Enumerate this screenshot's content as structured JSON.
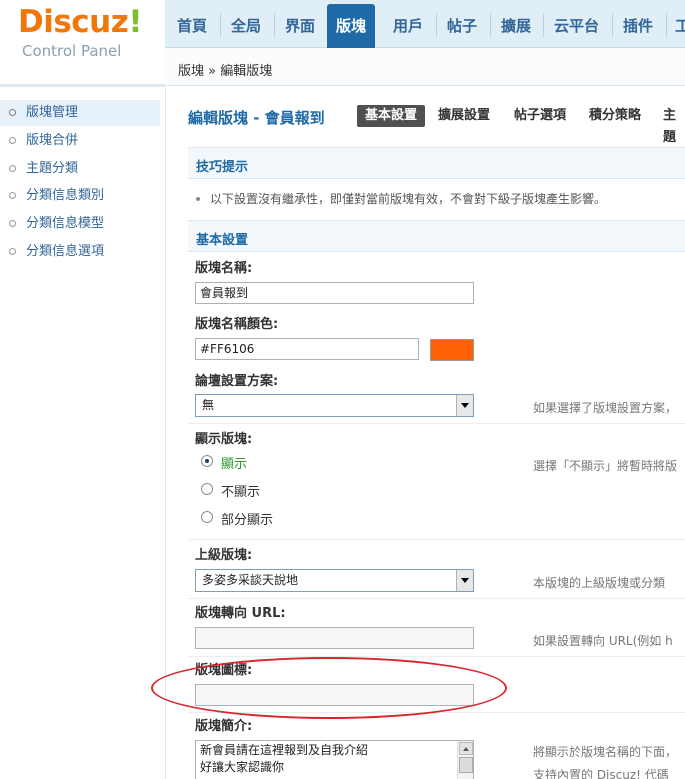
{
  "logo": {
    "brand": "Discuz",
    "bang": "!",
    "subtitle": "Control Panel"
  },
  "topnav": {
    "tabs": [
      "首頁",
      "全局",
      "界面",
      "版塊",
      "用戶",
      "帖子",
      "擴展",
      "云平台",
      "插件",
      "工"
    ],
    "active_index": 3
  },
  "breadcrumb": {
    "text": "版塊 » 編輯版塊"
  },
  "sidebar": {
    "items": [
      "版塊管理",
      "版塊合併",
      "主題分類",
      "分類信息類別",
      "分類信息模型",
      "分類信息選項"
    ],
    "active_index": 0
  },
  "main": {
    "title": "編輯版塊 - 會員報到",
    "subtabs": [
      "基本設置",
      "擴展設置",
      "帖子選項",
      "積分策略",
      "主題"
    ],
    "active_subtab": 0
  },
  "tips": {
    "heading": "技巧提示",
    "text": "以下設置沒有繼承性，即僅對當前版塊有效，不會對下級子版塊產生影響。"
  },
  "basic": {
    "heading": "基本設置",
    "name_label": "版塊名稱:",
    "name_value": "會員報到",
    "color_label": "版塊名稱顏色:",
    "color_value": "#FF6106",
    "swatch_color": "#FF6106",
    "scheme_label": "論壇設置方案:",
    "scheme_value": "無",
    "scheme_hint": "如果選擇了版塊設置方案，",
    "display_label": "顯示版塊:",
    "display_options": [
      "顯示",
      "不顯示",
      "部分顯示"
    ],
    "display_selected": 0,
    "display_hint": "選擇「不顯示」將暫時將版",
    "parent_label": "上級版塊:",
    "parent_value": "多姿多采談天說地",
    "parent_hint": "本版塊的上級版塊或分類",
    "redirect_label": "版塊轉向 URL:",
    "redirect_value": "",
    "redirect_hint": "如果設置轉向 URL(例如 h",
    "icon_label": "版塊圖標:",
    "icon_value": "",
    "desc_label": "版塊簡介:",
    "desc_lines": [
      "新會員請在這裡報到及自我介紹",
      "好讓大家認識你"
    ],
    "desc_hint1": "將顯示於版塊名稱的下面，",
    "desc_hint2": "支持內置的 Discuz! 代碼"
  },
  "colors": {
    "accent": "#1F6AA6",
    "annotation": "#D8262B",
    "display_green": "#2B9A2B"
  }
}
